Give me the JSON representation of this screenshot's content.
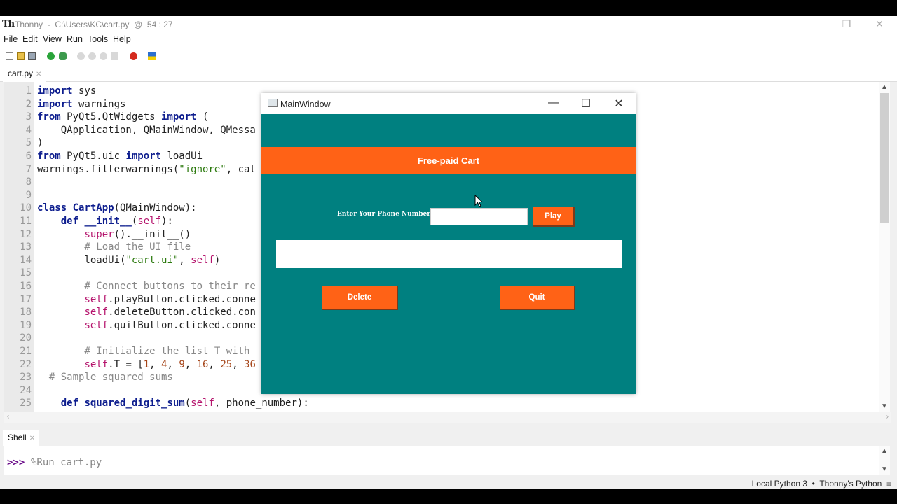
{
  "thonny": {
    "logo": "Th",
    "title": "Thonny  -  C:\\Users\\KC\\cart.py  @  54 : 27",
    "menu": [
      "File",
      "Edit",
      "View",
      "Run",
      "Tools",
      "Help"
    ],
    "editor_tab": "cart.py",
    "line_numbers": [
      "1",
      "2",
      "3",
      "4",
      "5",
      "6",
      "7",
      "8",
      "9",
      "10",
      "11",
      "12",
      "13",
      "14",
      "15",
      "16",
      "17",
      "18",
      "19",
      "20",
      "21",
      "22",
      "23",
      "24",
      "25"
    ],
    "shell_tab": "Shell",
    "shell_prompt": ">>>",
    "shell_command": "%Run cart.py",
    "status": "Local Python 3  •  Thonny's Python  ≡"
  },
  "code": {
    "l1_kw": "import",
    "l1_rest": " sys",
    "l2_kw": "import",
    "l2_rest": " warnings",
    "l3_kw1": "from",
    "l3_mid": " PyQt5.QtWidgets ",
    "l3_kw2": "import",
    "l3_rest": " (",
    "l4": "    QApplication, QMainWindow, QMessa",
    "l5": ")",
    "l6_kw1": "from",
    "l6_mid": " PyQt5.uic ",
    "l6_kw2": "import",
    "l6_rest": " loadUi",
    "l7_pre": "warnings.filterwarnings(",
    "l7_str": "\"ignore\"",
    "l7_rest": ", cat",
    "l10_kw": "class",
    "l10_fn": " CartApp",
    "l10_rest": "(QMainWindow):",
    "l11_ind": "    ",
    "l11_kw": "def",
    "l11_fn": " __init__",
    "l11_p": "(",
    "l11_self": "self",
    "l11_rest": "):",
    "l12_ind": "        ",
    "l12_super": "super",
    "l12_rest": "().__init__()",
    "l13": "        # Load the UI file",
    "l14_pre": "        loadUi(",
    "l14_str": "\"cart.ui\"",
    "l14_mid": ", ",
    "l14_self": "self",
    "l14_rest": ")",
    "l16": "        # Connect buttons to their re",
    "l17_ind": "        ",
    "l17_self": "self",
    "l17_rest": ".playButton.clicked.conne",
    "l18_ind": "        ",
    "l18_self": "self",
    "l18_rest": ".deleteButton.clicked.con",
    "l19_ind": "        ",
    "l19_self": "self",
    "l19_rest": ".quitButton.clicked.conne",
    "l21": "        # Initialize the list T with",
    "l22_ind": "        ",
    "l22_self": "self",
    "l22_mid": ".T = [",
    "l22_n1": "1",
    "l22_c1": ", ",
    "l22_n2": "4",
    "l22_c2": ", ",
    "l22_n3": "9",
    "l22_c3": ", ",
    "l22_n4": "16",
    "l22_c4": ", ",
    "l22_n5": "25",
    "l22_c5": ", ",
    "l22_n6": "36",
    "l23": "  # Sample squared sums",
    "l25_ind": "    ",
    "l25_kw": "def",
    "l25_fn": " squared_digit_sum",
    "l25_p": "(",
    "l25_self": "self",
    "l25_rest": ", phone_number):"
  },
  "qt_window": {
    "title": "MainWindow",
    "banner": "Free-paid Cart",
    "phone_label": "Enter Your Phone Number",
    "phone_value": "",
    "play_button": "Play",
    "delete_button": "Delete",
    "quit_button": "Quit",
    "colors": {
      "background": "#008080",
      "accent": "#ff6216"
    }
  }
}
